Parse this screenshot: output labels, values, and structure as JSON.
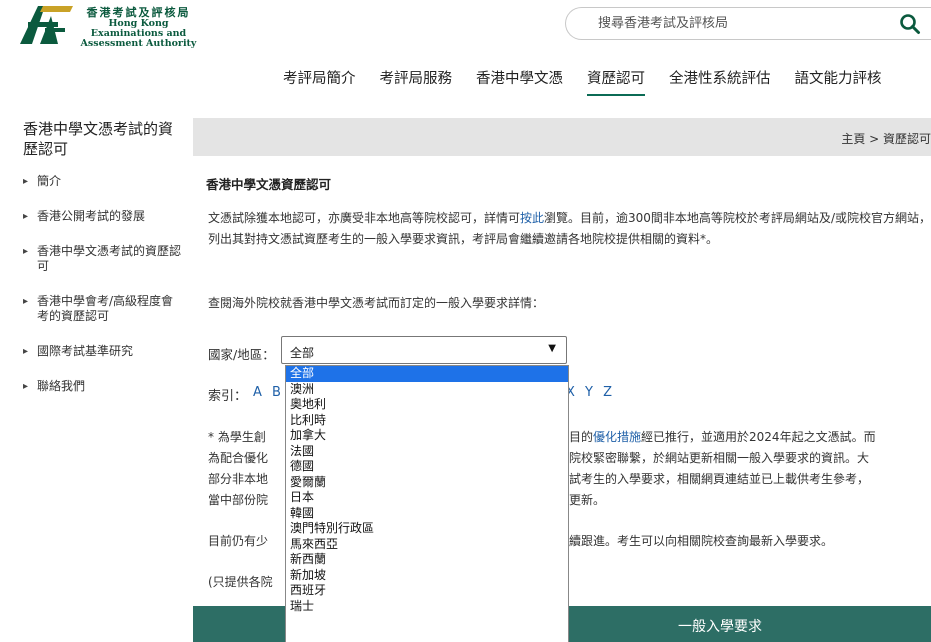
{
  "header": {
    "logo_zh": "香港考試及評核局",
    "logo_en_1": "Hong Kong",
    "logo_en_2": "Examinations and",
    "logo_en_3": "Assessment Authority",
    "search_placeholder": "搜尋香港考試及評核局"
  },
  "nav": {
    "items": [
      "考評局簡介",
      "考評局服務",
      "香港中學文憑",
      "資歷認可",
      "全港性系統評估",
      "語文能力評核"
    ]
  },
  "sidebar": {
    "title": "香港中學文憑考試的資歷認可",
    "items": [
      "簡介",
      "香港公開考試的發展",
      "香港中學文憑考試的資歷認可",
      "香港中學會考/高級程度會考的資歷認可",
      "國際考試基準研究",
      "聯絡我們"
    ]
  },
  "breadcrumb": "主頁 > 資歷認可",
  "content": {
    "section_title": "香港中學文憑資歷認可",
    "intro_before_link": "文憑試除獲本地認可，亦廣受非本地高等院校認可，詳情可",
    "intro_link": "按此",
    "intro_after_link": "瀏覽。目前，逾300間非本地高等院校於考評局網站及/或院校官方網站，列出其對持文憑試資歷考生的一般入學要求資訊，考評局會繼續邀請各地院校提供相關的資料*。",
    "query_text": "查閱海外院校就香港中學文憑考試而訂定的一般入學要求詳情：",
    "filter_label": "國家/地區：",
    "filter_value": "全部",
    "index_label": "索引：",
    "index_letters_left": "A B",
    "index_letters_right": "X Y Z",
    "note_line1_a": "* 為學生創",
    "note_line1_b": "目的",
    "note_line1_link": "優化措施",
    "note_line1_c": "經已推行，並適用於2024年起之文憑試。而",
    "note_line2_a": "為配合優化",
    "note_line2_b": "院校緊密聯繫，於網站更新相關一般入學要求的資訊。大",
    "note_line3_a": "部分非本地",
    "note_line3_b": "試考生的入學要求，相關網頁連結並已上載供考生參考，",
    "note_line4_a": "當中部份院",
    "note_line4_b": "更新。",
    "current_a": "目前仍有少",
    "current_b": "續跟進。考生可以向相關院校查詢最新入學要求。",
    "only_a": "(只提供各院"
  },
  "green_bar_label": "一般入學要求",
  "dropdown": {
    "options": [
      "全部",
      "澳洲",
      "奧地利",
      "比利時",
      "加拿大",
      "法國",
      "德國",
      "愛爾蘭",
      "日本",
      "韓國",
      "澳門特別行政區",
      "馬來西亞",
      "新西蘭",
      "新加坡",
      "西班牙",
      "瑞士"
    ],
    "selected_index": 0
  },
  "colors": {
    "brand_green": "#0b5a3e",
    "bar_green": "#2d6e65",
    "link_blue": "#1f60a8",
    "select_blue": "#1e72e8"
  }
}
